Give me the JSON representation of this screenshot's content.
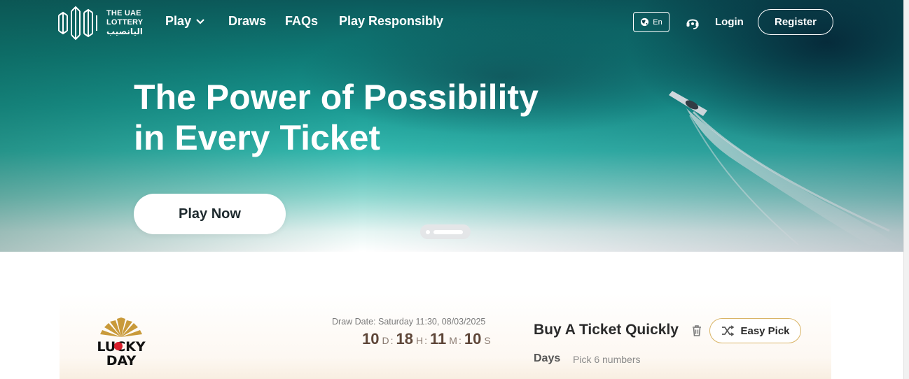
{
  "brand": {
    "line1": "THE UAE",
    "line2": "LOTTERY",
    "line3": "اليانصيب",
    "icon": "lottery-logo-icon",
    "color": "#ffffff"
  },
  "nav": {
    "play_label": "Play",
    "draws_label": "Draws",
    "faqs_label": "FAQs",
    "responsibly_label": "Play Responsibly",
    "language_label": "En",
    "login_label": "Login",
    "register_label": "Register"
  },
  "hero": {
    "headline_line1": "The Power of Possibility",
    "headline_line2": "in Every Ticket",
    "cta_label": "Play Now",
    "slides_count": 2,
    "active_slide": 2
  },
  "game": {
    "logo_line1": "LUCKY",
    "logo_line2": "DAY",
    "draw_date": "Draw Date: Saturday 11:30, 08/03/2025",
    "countdown": {
      "days": "10",
      "days_unit": "D",
      "hours": "18",
      "hours_unit": "H",
      "minutes": "11",
      "minutes_unit": "M",
      "seconds": "10",
      "seconds_unit": "S"
    }
  },
  "quick_buy": {
    "title": "Buy A Ticket Quickly",
    "easy_pick_label": "Easy Pick",
    "days_label": "Days",
    "pick_hint": "Pick 6 numbers"
  },
  "colors": {
    "accent_gold": "#d9b466",
    "countdown_brown": "#5e4638",
    "hero_teal": "#1a9a93"
  }
}
